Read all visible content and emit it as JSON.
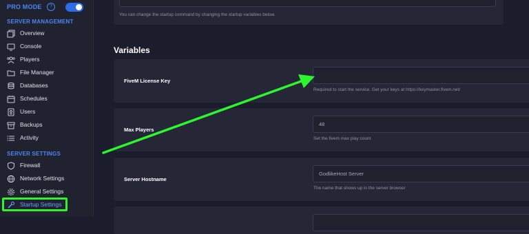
{
  "sidebar": {
    "pro_mode_label": "PRO MODE",
    "pro_mode_help": "?",
    "pro_mode_enabled": true,
    "server_management_title": "SERVER MANAGEMENT",
    "server_management_items": [
      {
        "label": "Overview",
        "icon": "copy-icon"
      },
      {
        "label": "Console",
        "icon": "monitor-icon"
      },
      {
        "label": "Players",
        "icon": "users-icon"
      },
      {
        "label": "File Manager",
        "icon": "folder-icon"
      },
      {
        "label": "Databases",
        "icon": "database-icon"
      },
      {
        "label": "Schedules",
        "icon": "calendar-icon"
      },
      {
        "label": "Users",
        "icon": "user-badge-icon"
      },
      {
        "label": "Backups",
        "icon": "archive-icon"
      },
      {
        "label": "Activity",
        "icon": "list-icon"
      }
    ],
    "server_settings_title": "SERVER SETTINGS",
    "server_settings_items": [
      {
        "label": "Firewall",
        "icon": "shield-icon"
      },
      {
        "label": "Network Settings",
        "icon": "network-icon"
      },
      {
        "label": "General Settings",
        "icon": "gear-icon"
      },
      {
        "label": "Startup Settings",
        "icon": "wrench-icon",
        "active": true
      }
    ]
  },
  "startup": {
    "help": "You can change the startup command by changing the startup variables below."
  },
  "variables": {
    "heading": "Variables",
    "items": [
      {
        "label": "FiveM License Key",
        "value": "",
        "help": "Required to start the service. Get your keys at https://keymaster.fivem.net/"
      },
      {
        "label": "Max Players",
        "value": "48",
        "help": "Set the fivem max play count"
      },
      {
        "label": "Server Hostname",
        "value": "GodlikeHost Server",
        "help": "The name that shows up in the server browser"
      }
    ]
  },
  "colors": {
    "accent": "#4a87f0",
    "annotation": "#2ef52e",
    "background": "#1c1d2c",
    "panel": "#252736"
  }
}
